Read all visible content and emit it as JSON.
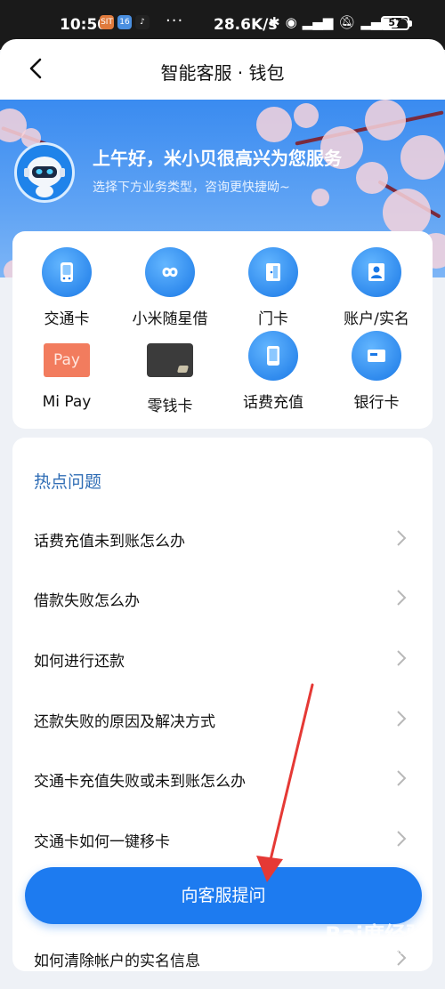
{
  "status_bar": {
    "time": "10:50",
    "speed": "28.6K/s",
    "battery": "57",
    "apps": [
      {
        "name": "app-icon-orange",
        "label": "SIT",
        "color": "#e07a3c"
      },
      {
        "name": "app-icon-blue",
        "label": "16",
        "color": "#4a8fe0"
      },
      {
        "name": "app-icon-tiktok",
        "label": "♪",
        "color": "#222222"
      }
    ],
    "dots": "···"
  },
  "header": {
    "title": "智能客服 · 钱包"
  },
  "banner": {
    "greeting": "上午好，米小贝很高兴为您服务",
    "subtitle": "选择下方业务类型，咨询更快捷呦~"
  },
  "services": [
    {
      "label": "交通卡",
      "icon": "transit-card-icon"
    },
    {
      "label": "小米随星借",
      "icon": "infinity-loan-icon"
    },
    {
      "label": "门卡",
      "icon": "door-card-icon"
    },
    {
      "label": "账户/实名",
      "icon": "account-icon"
    },
    {
      "label": "Mi Pay",
      "icon": "mi-pay-icon",
      "tile_text": "Pay"
    },
    {
      "label": "零钱卡",
      "icon": "change-card-icon"
    },
    {
      "label": "话费充值",
      "icon": "phone-recharge-icon"
    },
    {
      "label": "银行卡",
      "icon": "bank-card-icon"
    }
  ],
  "faq": {
    "title": "热点问题",
    "items": [
      "话费充值未到账怎么办",
      "借款失败怎么办",
      "如何进行还款",
      "还款失败的原因及解决方式",
      "交通卡充值失败或未到账怎么办",
      "交通卡如何一键移卡",
      "如何清除帐户的实名信息"
    ]
  },
  "ask_button": "向客服提问",
  "watermark": {
    "logo": "Bai度经验",
    "url": "jingyan.baidu.com"
  },
  "colors": {
    "primary": "#1d7bf0",
    "faq_title": "#2f6db5",
    "annotation_arrow": "#e53935"
  }
}
